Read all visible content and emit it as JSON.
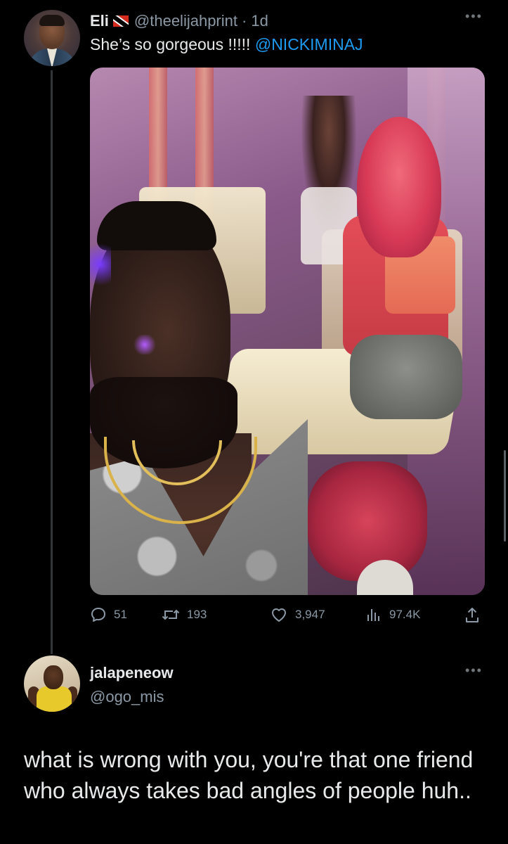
{
  "tweet": {
    "author": {
      "display_name": "Eli",
      "flag_icon": "trinidad-flag-icon",
      "handle": "@theelijahprint",
      "separator": "·",
      "time": "1d"
    },
    "text_prefix": "She’s so gorgeous !!!!! ",
    "mention": "@NICKIMINAJ",
    "stats": {
      "replies": "51",
      "retweets": "193",
      "likes": "3,947",
      "views": "97.4K"
    },
    "more_icon": "more-icon"
  },
  "reply": {
    "author": {
      "display_name": "jalapeneow",
      "handle": "@ogo_mis"
    },
    "text": "what is wrong with you, you're that one friend who always takes bad angles of people huh..",
    "more_icon": "more-icon"
  },
  "colors": {
    "background": "#000000",
    "text": "#e7e9ea",
    "secondary_text": "#8b98a5",
    "link": "#1d9bf0",
    "thread_line": "#333639"
  }
}
